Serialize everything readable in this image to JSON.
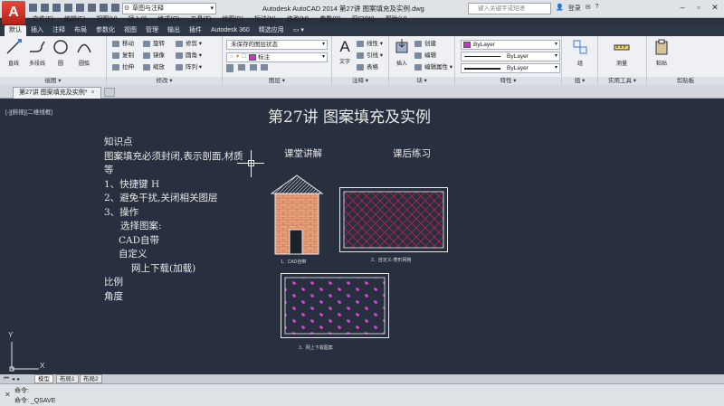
{
  "titlebar": {
    "app_letter": "A",
    "workspace": "草图与注释",
    "title": "Autodesk AutoCAD 2014    第27讲 图案填充及实例.dwg",
    "search_placeholder": "键入关键字或短语",
    "user": "登录",
    "right_items": [
      "✉",
      "?"
    ]
  },
  "menu": [
    "文件(F)",
    "编辑(E)",
    "视图(V)",
    "插入(I)",
    "格式(O)",
    "工具(T)",
    "绘图(D)",
    "标注(N)",
    "修改(M)",
    "参数(P)",
    "窗口(W)",
    "帮助(H)"
  ],
  "ribbon_tabs": [
    "默认",
    "插入",
    "注释",
    "布局",
    "参数化",
    "视图",
    "管理",
    "输出",
    "插件",
    "Autodesk 360",
    "精选应用",
    "▭ ▾"
  ],
  "panels": {
    "draw": {
      "label": "绘图 ▾",
      "tools": [
        "直线",
        "多段线",
        "圆",
        "圆弧"
      ]
    },
    "modify": {
      "label": "修改 ▾",
      "tools": [
        "移动",
        "旋转",
        "修剪 ▾",
        "复制",
        "镜像",
        "圆角 ▾",
        "拉伸",
        "缩放",
        "阵列 ▾"
      ]
    },
    "layers": {
      "label": "图层 ▾",
      "state": "未保存的图层状态",
      "current": "标注"
    },
    "annotation": {
      "label": "注释 ▾",
      "text": "文字",
      "tools": [
        "线性 ▾",
        "引线 ▾",
        "表格"
      ]
    },
    "block": {
      "label": "块 ▾",
      "insert": "插入",
      "tools": [
        "创建",
        "编辑",
        "编辑属性 ▾"
      ]
    },
    "properties": {
      "label": "特性 ▾",
      "color": "ByLayer",
      "linetype": "ByLayer",
      "lineweight": "ByLayer",
      "color_hex": "#cc33cc"
    },
    "groups": {
      "label": "组 ▾",
      "tool": "组"
    },
    "utilities": {
      "label": "实用工具 ▾",
      "tool": "测量"
    },
    "clipboard": {
      "label": "剪贴板",
      "tool": "粘贴"
    }
  },
  "doc_tab": {
    "label": "第27讲 图案填充及实例*",
    "close": "×"
  },
  "canvas": {
    "viewport_label": "[-][俯视][二维线框]",
    "title": "第27讲   图案填充及实例",
    "notes": [
      "知识点",
      "图案填充必须封闭,表示剖面,材质",
      "等",
      "1、快捷键 H",
      "2、避免干扰,关闭相关图层",
      "3、操作",
      "  选择图案:",
      "  CAD自带",
      "  自定义",
      "  网上下载(加载)",
      "比例",
      "角度"
    ],
    "label_class": "课堂讲解",
    "label_practice": "课后练习",
    "caption1": "1、CAD自带",
    "caption2": "2、自定义-菱形网格",
    "caption3": "3、网上下载图案",
    "ucs_y": "Y",
    "ucs_x": "X",
    "hatch_color": "#d0205a",
    "dots_color": "#e040e0",
    "brick_color": "#e8a07a"
  },
  "layout_tabs": [
    "模型",
    "布局1",
    "布局2"
  ],
  "cmdline": {
    "line1": "命令:",
    "line2": "命令: _QSAVE"
  }
}
